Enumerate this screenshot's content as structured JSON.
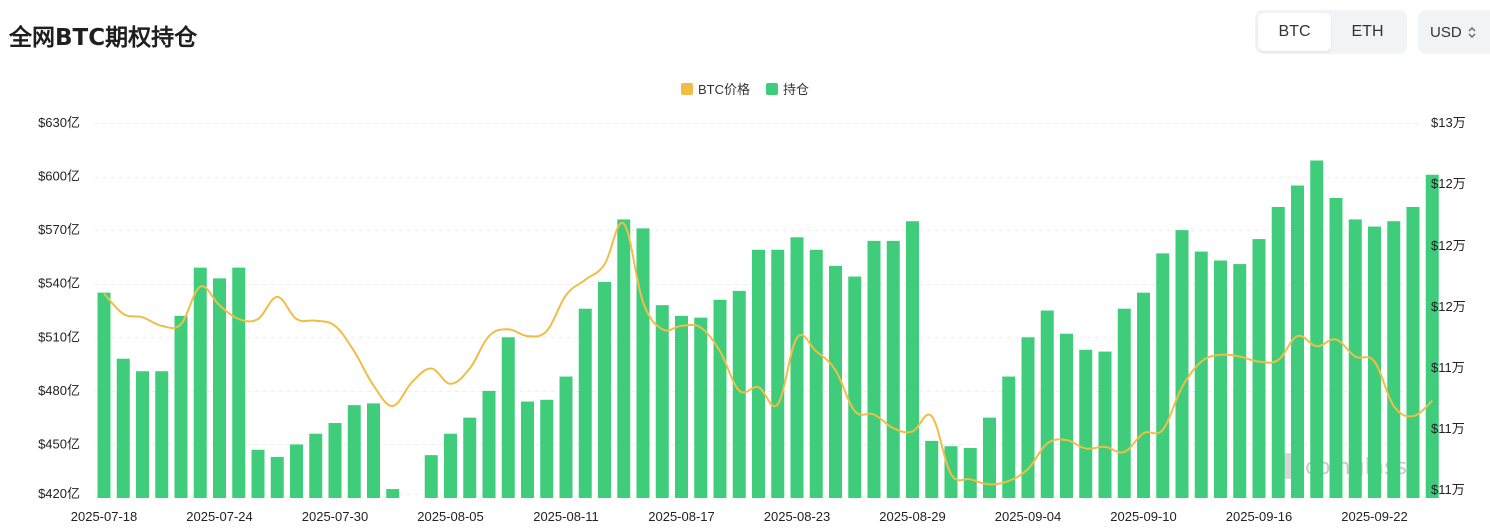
{
  "title": "全网BTC期权持仓",
  "coin_tabs": [
    {
      "label": "BTC",
      "active": true
    },
    {
      "label": "ETH",
      "active": false
    }
  ],
  "currency": {
    "label": "USD",
    "icon": "chevron-updown-icon"
  },
  "watermark": "coinglass",
  "colors": {
    "bar": "#3fcd7b",
    "line": "#f0bd49",
    "grid": "#eeeeee"
  },
  "chart_data": {
    "type": "bar",
    "title": "",
    "legend_position": "top-center",
    "grid": true,
    "series": [
      {
        "name": "BTC价格",
        "type": "line",
        "axis": "right"
      },
      {
        "name": "持仓",
        "type": "bar",
        "axis": "left"
      }
    ],
    "x": [
      "2025-07-18",
      "2025-07-19",
      "2025-07-20",
      "2025-07-21",
      "2025-07-22",
      "2025-07-23",
      "2025-07-24",
      "2025-07-25",
      "2025-07-26",
      "2025-07-27",
      "2025-07-28",
      "2025-07-29",
      "2025-07-30",
      "2025-07-31",
      "2025-08-01",
      "2025-08-02",
      "2025-08-03",
      "2025-08-04",
      "2025-08-05",
      "2025-08-06",
      "2025-08-07",
      "2025-08-08",
      "2025-08-09",
      "2025-08-10",
      "2025-08-11",
      "2025-08-12",
      "2025-08-13",
      "2025-08-14",
      "2025-08-15",
      "2025-08-16",
      "2025-08-17",
      "2025-08-18",
      "2025-08-19",
      "2025-08-20",
      "2025-08-21",
      "2025-08-22",
      "2025-08-23",
      "2025-08-24",
      "2025-08-25",
      "2025-08-26",
      "2025-08-27",
      "2025-08-28",
      "2025-08-29",
      "2025-08-30",
      "2025-08-31",
      "2025-09-01",
      "2025-09-02",
      "2025-09-03",
      "2025-09-04",
      "2025-09-05",
      "2025-09-06",
      "2025-09-07",
      "2025-09-08",
      "2025-09-09",
      "2025-09-10",
      "2025-09-11",
      "2025-09-12",
      "2025-09-13",
      "2025-09-14",
      "2025-09-15",
      "2025-09-16",
      "2025-09-17",
      "2025-09-18",
      "2025-09-19",
      "2025-09-20",
      "2025-09-21",
      "2025-09-22",
      "2025-09-23",
      "2025-09-24"
    ],
    "x_tick_labels": [
      "2025-07-18",
      "2025-07-24",
      "2025-07-30",
      "2025-08-05",
      "2025-08-11",
      "2025-08-17",
      "2025-08-23",
      "2025-08-29",
      "2025-09-04",
      "2025-09-10",
      "2025-09-16",
      "2025-09-22"
    ],
    "open_interest_yi": [
      535,
      498,
      491,
      491,
      522,
      549,
      543,
      549,
      447,
      443,
      450,
      456,
      462,
      472,
      473,
      425,
      418,
      444,
      456,
      465,
      480,
      510,
      474,
      475,
      488,
      526,
      541,
      576,
      571,
      528,
      522,
      521,
      531,
      536,
      559,
      559,
      566,
      559,
      550,
      544,
      564,
      564,
      575,
      452,
      449,
      448,
      465,
      488,
      510,
      525,
      512,
      503,
      502,
      526,
      535,
      557,
      570,
      558,
      553,
      551,
      565,
      583,
      595,
      609,
      588,
      576,
      572,
      575,
      583,
      601
    ],
    "btc_price": [
      119300,
      118100,
      117900,
      117400,
      117500,
      119700,
      118600,
      117800,
      117800,
      119100,
      117800,
      117700,
      117400,
      115900,
      113900,
      112700,
      114100,
      114900,
      114000,
      114900,
      116800,
      117200,
      116800,
      117100,
      119200,
      120100,
      121000,
      123400,
      118800,
      117200,
      117400,
      117300,
      115900,
      113600,
      113800,
      112800,
      116700,
      115900,
      114800,
      112400,
      112200,
      111400,
      111200,
      112100,
      108700,
      108400,
      108100,
      108300,
      109000,
      110500,
      110700,
      110200,
      110300,
      110000,
      111100,
      111300,
      113800,
      115300,
      115700,
      115600,
      115300,
      115400,
      116800,
      116200,
      116600,
      115600,
      115300,
      112700,
      112100,
      113000
    ],
    "y_left": {
      "label": "",
      "ticks": [
        "$420亿",
        "$450亿",
        "$480亿",
        "$510亿",
        "$540亿",
        "$570亿",
        "$600亿",
        "$630亿"
      ],
      "min": 420,
      "max": 630
    },
    "y_right": {
      "label": "",
      "ticks": [
        "$11万",
        "$11万",
        "$11万",
        "$12万",
        "$12万",
        "$12万",
        "$12万",
        "$13万"
      ]
    }
  }
}
